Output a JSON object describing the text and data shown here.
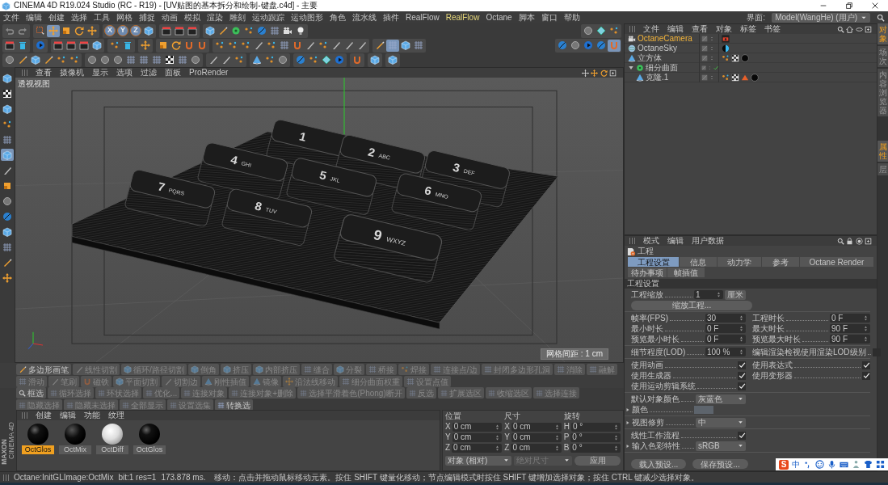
{
  "window": {
    "title": "CINEMA 4D R19.024 Studio (RC - R19) - [UV贴图的基本拆分和绘制-键盘.c4d] - 主要"
  },
  "menu_bar": {
    "items": [
      {
        "label": "文件",
        "highlighted": false
      },
      {
        "label": "编辑",
        "highlighted": false
      },
      {
        "label": "创建",
        "highlighted": false
      },
      {
        "label": "选择",
        "highlighted": false
      },
      {
        "label": "工具",
        "highlighted": false
      },
      {
        "label": "网格",
        "highlighted": false
      },
      {
        "label": "捕捉",
        "highlighted": false
      },
      {
        "label": "动画",
        "highlighted": false
      },
      {
        "label": "模拟",
        "highlighted": false
      },
      {
        "label": "渲染",
        "highlighted": false
      },
      {
        "label": "雕刻",
        "highlighted": false
      },
      {
        "label": "运动跟踪",
        "highlighted": false
      },
      {
        "label": "运动图形",
        "highlighted": false
      },
      {
        "label": "角色",
        "highlighted": false
      },
      {
        "label": "流水线",
        "highlighted": false
      },
      {
        "label": "插件",
        "highlighted": false
      },
      {
        "label": "RealFlow",
        "highlighted": false
      },
      {
        "label": "RealFlow",
        "highlighted": true
      },
      {
        "label": "Octane",
        "highlighted": false
      },
      {
        "label": "脚本",
        "highlighted": false
      },
      {
        "label": "窗口",
        "highlighted": false
      },
      {
        "label": "帮助",
        "highlighted": false
      }
    ],
    "layout_label": "界面:",
    "layout_value": "Model(WangHe) (用户)"
  },
  "toolbars": [
    {
      "groups": [
        [
          {
            "selected": false
          },
          {
            "selected": false
          }
        ],
        [
          {
            "selected": false
          },
          {
            "selected": true
          },
          {
            "selected": false
          },
          {
            "selected": false
          },
          {
            "selected": false
          }
        ],
        [
          {
            "label": "X",
            "selected": true
          },
          {
            "label": "Y",
            "selected": true
          },
          {
            "label": "Z",
            "selected": true
          },
          {
            "selected": false
          }
        ],
        [
          {
            "selected": false
          },
          {
            "selected": false
          },
          {
            "selected": false
          }
        ],
        [
          {
            "selected": false
          },
          {
            "selected": false
          },
          {
            "selected": false
          },
          {
            "selected": false
          },
          {
            "selected": false
          },
          {
            "selected": false
          },
          {
            "selected": false
          },
          {
            "selected": false
          }
        ]
      ],
      "right_groups": [
        [
          {
            "selected": false
          },
          {
            "selected": false
          },
          {
            "selected": false
          }
        ]
      ]
    },
    {
      "groups": [
        [
          {
            "selected": false
          },
          {
            "selected": false
          }
        ],
        [
          {
            "selected": false
          }
        ],
        [
          {
            "selected": false
          },
          {
            "selected": false
          },
          {
            "selected": false
          },
          {
            "selected": false
          }
        ],
        [
          {
            "selected": false
          },
          {
            "selected": false
          }
        ],
        [
          {
            "selected": false
          }
        ],
        [
          {
            "selected": false
          },
          {
            "selected": false
          },
          {
            "selected": false
          },
          {
            "selected": false
          }
        ],
        [
          {
            "selected": false
          },
          {
            "selected": false
          },
          {
            "selected": false
          },
          {
            "selected": false
          },
          {
            "selected": false
          },
          {
            "selected": false
          },
          {
            "selected": false
          },
          {
            "selected": false
          },
          {
            "selected": false
          },
          {
            "selected": false
          },
          {
            "selected": false
          },
          {
            "selected": false
          }
        ],
        [
          {
            "selected": false
          },
          {
            "selected": true
          },
          {
            "selected": false
          },
          {
            "selected": false
          }
        ]
      ],
      "right_groups": [
        [
          {
            "selected": false
          },
          {
            "selected": false
          },
          {
            "selected": false
          },
          {
            "selected": false
          },
          {
            "selected": true
          }
        ]
      ]
    },
    {
      "groups": [
        [
          {
            "selected": false
          },
          {
            "selected": false
          },
          {
            "selected": false
          },
          {
            "selected": false
          },
          {
            "selected": false
          },
          {
            "selected": false
          }
        ],
        [
          {
            "selected": false
          },
          {
            "selected": false
          },
          {
            "selected": false
          },
          {
            "selected": false
          },
          {
            "selected": false
          },
          {
            "selected": false
          },
          {
            "selected": false
          },
          {
            "selected": false
          },
          {
            "selected": false
          }
        ],
        [
          {
            "selected": false
          },
          {
            "selected": false
          },
          {
            "selected": false
          }
        ],
        [
          {
            "selected": false
          },
          {
            "selected": false
          },
          {
            "selected": false
          }
        ],
        [
          {
            "selected": false
          },
          {
            "selected": false
          },
          {
            "selected": false
          },
          {
            "selected": false
          }
        ],
        [
          {
            "selected": false
          }
        ],
        [
          {
            "selected": false
          }
        ],
        [
          {
            "selected": false
          }
        ]
      ]
    }
  ],
  "left_tools": [
    {
      "selected": false
    },
    {
      "selected": false
    },
    {
      "selected": false
    },
    {
      "selected": false
    },
    {
      "selected": false
    },
    {
      "selected": true
    },
    {
      "selected": false
    },
    {
      "selected": false
    },
    {
      "selected": false
    },
    {
      "selected": false
    },
    {
      "selected": false
    },
    {
      "selected": false
    },
    {
      "selected": false
    },
    {
      "selected": false
    }
  ],
  "viewport": {
    "menu": [
      "查看",
      "摄像机",
      "显示",
      "选项",
      "过滤",
      "面板",
      "ProRender"
    ],
    "label": "透视视图",
    "grid_spacing": "网格间距 : 1 cm",
    "keys": [
      {
        "number": "1"
      },
      {
        "number": "2",
        "letters": "ABC"
      },
      {
        "number": "3",
        "letters": "DEF"
      },
      {
        "number": "4",
        "letters": "GHI"
      },
      {
        "number": "5",
        "letters": "JKL"
      },
      {
        "number": "6",
        "letters": "MNO"
      },
      {
        "number": "7",
        "letters": "PQRS"
      },
      {
        "number": "8",
        "letters": "TUV"
      },
      {
        "number": "9",
        "letters": "WXYZ"
      }
    ]
  },
  "modeling_tools": [
    {
      "label": "多边形画笔",
      "disabled": false
    },
    {
      "label": "线性切割",
      "disabled": true
    },
    {
      "label": "循环/路径切割",
      "disabled": true
    },
    {
      "label": "倒角",
      "disabled": true
    },
    {
      "label": "挤压",
      "disabled": true
    },
    {
      "label": "内部挤压",
      "disabled": true
    },
    {
      "label": "缝合",
      "disabled": true
    },
    {
      "label": "分裂",
      "disabled": true
    },
    {
      "label": "桥接",
      "disabled": true
    },
    {
      "label": "焊接",
      "disabled": true
    },
    {
      "label": "连接点/边",
      "disabled": true
    },
    {
      "label": "封闭多边形孔洞",
      "disabled": true
    },
    {
      "label": "消除",
      "disabled": true
    },
    {
      "label": "融解",
      "disabled": true
    },
    {
      "label": "滑动",
      "disabled": true
    },
    {
      "label": "笔刷",
      "disabled": true
    },
    {
      "label": "磁铁",
      "disabled": true
    },
    {
      "label": "平面切割",
      "disabled": true
    },
    {
      "label": "切割边",
      "disabled": true
    },
    {
      "label": "刚性插值",
      "disabled": true
    },
    {
      "label": "镜像",
      "disabled": true
    },
    {
      "label": "沿法线移动",
      "disabled": true
    },
    {
      "label": "细分曲面权重",
      "disabled": true
    },
    {
      "label": "设置点值",
      "disabled": true
    }
  ],
  "selection_tools": [
    {
      "label": "框选",
      "disabled": false
    },
    {
      "label": "循环选择",
      "disabled": true
    },
    {
      "label": "环状选择",
      "disabled": true
    },
    {
      "label": "优化...",
      "disabled": true
    },
    {
      "label": "连接对象",
      "disabled": true
    },
    {
      "label": "连接对象+删除",
      "disabled": true
    },
    {
      "label": "选择平滑着色(Phong)断开",
      "disabled": true
    },
    {
      "label": "反选",
      "disabled": true
    },
    {
      "label": "扩展选区",
      "disabled": true
    },
    {
      "label": "收缩选区",
      "disabled": true
    },
    {
      "label": "选择连接",
      "disabled": true
    },
    {
      "label": "隐藏选择",
      "disabled": true
    },
    {
      "label": "隐藏未选择",
      "disabled": true
    },
    {
      "label": "全部显示",
      "disabled": true
    },
    {
      "label": "设置选集",
      "disabled": true
    },
    {
      "label": "转换选",
      "disabled": false
    }
  ],
  "logo": {
    "brand": "MAXON",
    "product": "CINEMA 4D"
  },
  "material_manager": {
    "menu": [
      "创建",
      "编辑",
      "功能",
      "纹理"
    ],
    "materials": [
      {
        "name": "OctGlos",
        "kind": "glossy",
        "selected": true
      },
      {
        "name": "OctMix",
        "kind": "mix",
        "selected": false
      },
      {
        "name": "OctDiff",
        "kind": "diffuse",
        "selected": false
      },
      {
        "name": "OctGlos",
        "kind": "glossy",
        "selected": false
      }
    ]
  },
  "coordinates": {
    "headers": [
      "位置",
      "尺寸",
      "旋转"
    ],
    "rows": [
      [
        {
          "axis": "X",
          "value": "0 cm"
        },
        {
          "axis": "X",
          "value": "0 cm"
        },
        {
          "axis": "H",
          "value": "0 °"
        }
      ],
      [
        {
          "axis": "Y",
          "value": "0 cm"
        },
        {
          "axis": "Y",
          "value": "0 cm"
        },
        {
          "axis": "P",
          "value": "0 °"
        }
      ],
      [
        {
          "axis": "Z",
          "value": "0 cm"
        },
        {
          "axis": "Z",
          "value": "0 cm"
        },
        {
          "axis": "B",
          "value": "0 °"
        }
      ]
    ],
    "mode": {
      "value": "对象 (相对)",
      "disabled": false
    },
    "size_mode": {
      "value": "绝对尺寸",
      "disabled": true
    },
    "apply": "应用"
  },
  "object_manager": {
    "menu": [
      "文件",
      "编辑",
      "查看",
      "对象",
      "标签",
      "书签"
    ],
    "objects": [
      {
        "name": "OctaneCamera",
        "kind": "camera",
        "selected": true,
        "check": false
      },
      {
        "name": "OctaneSky",
        "kind": "sky",
        "selected": false,
        "check": false
      },
      {
        "name": "立方体",
        "kind": "polygon",
        "selected": false,
        "check": false
      },
      {
        "name": "细分曲面",
        "kind": "subdivision",
        "selected": false,
        "check": true,
        "expanded": true,
        "children": [
          {
            "name": "克隆.1",
            "kind": "polygon",
            "selected": false,
            "check": false
          }
        ]
      }
    ]
  },
  "attribute_manager": {
    "menu": [
      "模式",
      "编辑",
      "用户数据"
    ],
    "title": "工程",
    "tabs": [
      {
        "label": "工程设置",
        "selected": true
      },
      {
        "label": "信息",
        "selected": false
      },
      {
        "label": "动力学",
        "selected": false
      },
      {
        "label": "参考",
        "selected": false
      },
      {
        "label": "Octane Render",
        "selected": false
      },
      {
        "label": "待办事项",
        "selected": false
      },
      {
        "label": "帧插值",
        "selected": false
      }
    ],
    "section": "工程设置",
    "groups": [
      [
        [
          {
            "kind": "number",
            "label": "工程缩放",
            "value": "1",
            "unit": "厘米"
          }
        ],
        [
          {
            "kind": "button",
            "label": "缩放工程..."
          }
        ]
      ],
      [
        [
          {
            "kind": "number",
            "label": "帧率(FPS)",
            "value": "30"
          },
          {
            "kind": "number",
            "label": "工程时长",
            "value": "0 F"
          }
        ],
        [
          {
            "kind": "number",
            "label": "最小时长",
            "value": "0 F"
          },
          {
            "kind": "number",
            "label": "最大时长",
            "value": "90 F"
          }
        ],
        [
          {
            "kind": "number",
            "label": "预览最小时长",
            "value": "0 F"
          },
          {
            "kind": "number",
            "label": "预览最大时长",
            "value": "90 F"
          }
        ]
      ],
      [
        [
          {
            "kind": "number",
            "label": "细节程度(LOD)",
            "value": "100 %"
          },
          {
            "kind": "check",
            "label": "编辑渲染检视使用渲染LOD级别",
            "checked": false
          }
        ]
      ],
      [
        [
          {
            "kind": "check",
            "label": "使用动画",
            "checked": true
          },
          {
            "kind": "check",
            "label": "使用表达式",
            "checked": true
          }
        ],
        [
          {
            "kind": "check",
            "label": "使用生成器",
            "checked": true
          },
          {
            "kind": "check",
            "label": "使用变形器",
            "checked": true
          }
        ],
        [
          {
            "kind": "check",
            "label": "使用运动剪辑系统",
            "checked": true
          }
        ]
      ],
      [
        [
          {
            "kind": "dropdown",
            "label": "默认对象颜色",
            "value": "灰蓝色"
          }
        ],
        [
          {
            "kind": "color",
            "label": "颜色",
            "color": "#5d646c",
            "expanded": false
          }
        ]
      ],
      [
        [
          {
            "kind": "dropdown",
            "label": "视图修剪",
            "value": "中",
            "expanded": false
          }
        ]
      ],
      [
        [
          {
            "kind": "check",
            "label": "线性工作流程",
            "checked": true
          }
        ],
        [
          {
            "kind": "dropdown",
            "label": "输入色彩特性",
            "value": "sRGB",
            "expanded": false
          }
        ]
      ]
    ],
    "footer_buttons": [
      "载入预设...",
      "保存预设..."
    ]
  },
  "side_tabs_top": [
    {
      "label": "对象",
      "selected": true
    },
    {
      "label": "场次",
      "selected": false
    },
    {
      "label": "内容浏览器",
      "selected": false
    }
  ],
  "side_tabs_bottom": [
    {
      "label": "属性",
      "selected": true
    },
    {
      "label": "层",
      "selected": false
    }
  ],
  "status_bar": {
    "render_info": "Octane:InitGLImage:OctMix",
    "bits": "bit:1 res=1",
    "time": "173.878 ms.",
    "message": "移动：点击并拖动鼠标移动元素。按住 SHIFT 键量化移动；节点编辑模式时按住 SHIFT 键增加选择对象；按住 CTRL 键减少选择对象。"
  },
  "ime_bar": {
    "logo": "S",
    "mode": "中"
  }
}
